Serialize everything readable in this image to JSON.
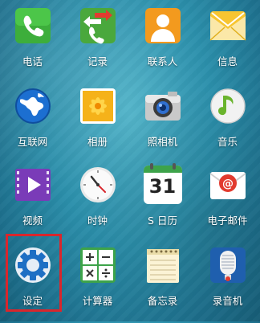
{
  "apps": [
    {
      "label": "电话",
      "icon": "phone-icon"
    },
    {
      "label": "记录",
      "icon": "call-log-icon"
    },
    {
      "label": "联系人",
      "icon": "contacts-icon"
    },
    {
      "label": "信息",
      "icon": "messages-icon"
    },
    {
      "label": "互联网",
      "icon": "internet-globe-icon"
    },
    {
      "label": "相册",
      "icon": "gallery-icon"
    },
    {
      "label": "照相机",
      "icon": "camera-icon"
    },
    {
      "label": "音乐",
      "icon": "music-icon"
    },
    {
      "label": "视频",
      "icon": "video-icon"
    },
    {
      "label": "时钟",
      "icon": "clock-icon"
    },
    {
      "label": "S 日历",
      "icon": "calendar-icon"
    },
    {
      "label": "电子邮件",
      "icon": "email-icon"
    },
    {
      "label": "设定",
      "icon": "settings-gear-icon"
    },
    {
      "label": "计算器",
      "icon": "calculator-icon"
    },
    {
      "label": "备忘录",
      "icon": "memo-icon"
    },
    {
      "label": "录音机",
      "icon": "voice-recorder-icon"
    }
  ],
  "calendar_day": "31",
  "highlighted_app": "设定",
  "colors": {
    "highlight": "#d9262c",
    "phone_green": "#3dae3b",
    "contacts_orange": "#f39a1e",
    "video_purple": "#7a3bb8",
    "settings_blue": "#1e6fc4"
  }
}
